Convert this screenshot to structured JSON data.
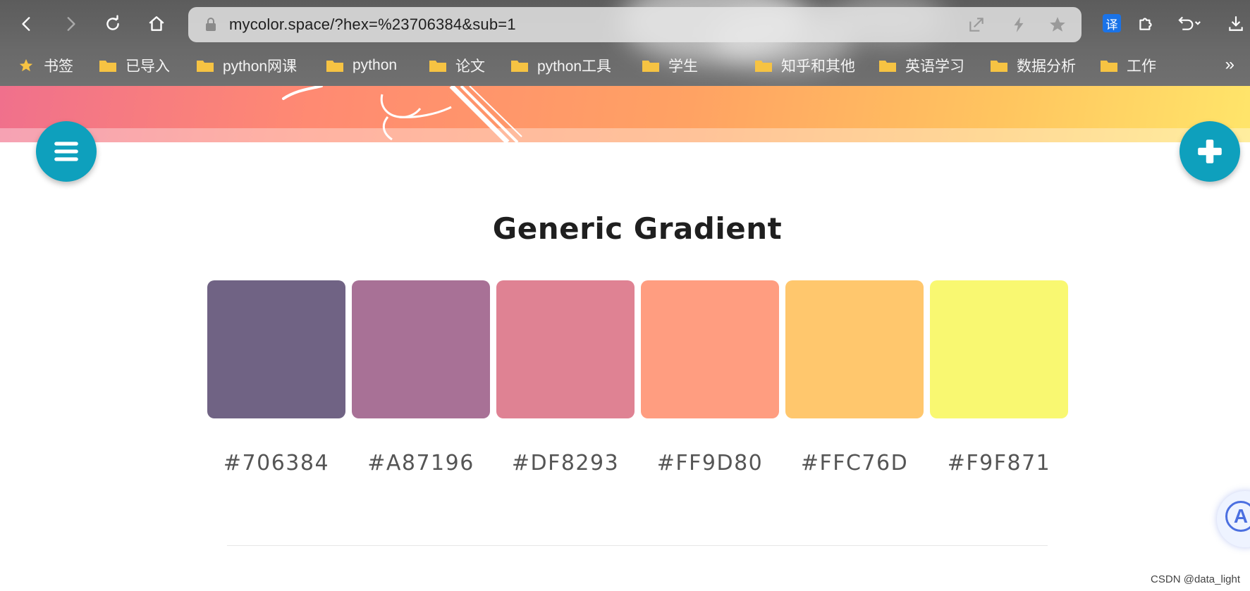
{
  "browser": {
    "url": "mycolor.space/?hex=%23706384&sub=1",
    "translate_badge": "译",
    "bookmarks": [
      {
        "label": "书签",
        "icon": "star-icon"
      },
      {
        "label": "已导入",
        "icon": "folder-icon"
      },
      {
        "label": "python网课",
        "icon": "folder-icon"
      },
      {
        "label": "python",
        "icon": "folder-icon"
      },
      {
        "label": "论文",
        "icon": "folder-icon"
      },
      {
        "label": "python工具",
        "icon": "folder-icon"
      },
      {
        "label": "学生",
        "icon": "folder-icon"
      },
      {
        "label": "知乎和其他",
        "icon": "folder-icon"
      },
      {
        "label": "英语学习",
        "icon": "folder-icon"
      },
      {
        "label": "数据分析",
        "icon": "folder-icon"
      },
      {
        "label": "工作",
        "icon": "folder-icon"
      }
    ],
    "more": "»"
  },
  "palette": {
    "title": "Generic Gradient",
    "colors": [
      {
        "hex": "#706384"
      },
      {
        "hex": "#A87196"
      },
      {
        "hex": "#DF8293"
      },
      {
        "hex": "#FF9D80"
      },
      {
        "hex": "#FFC76D"
      },
      {
        "hex": "#F9F871"
      }
    ]
  },
  "colors": {
    "fab": "#0ea0bd",
    "folder": "#f6c343",
    "star": "#f6c343"
  },
  "helper_badge": "A",
  "watermark": "CSDN @data_light"
}
